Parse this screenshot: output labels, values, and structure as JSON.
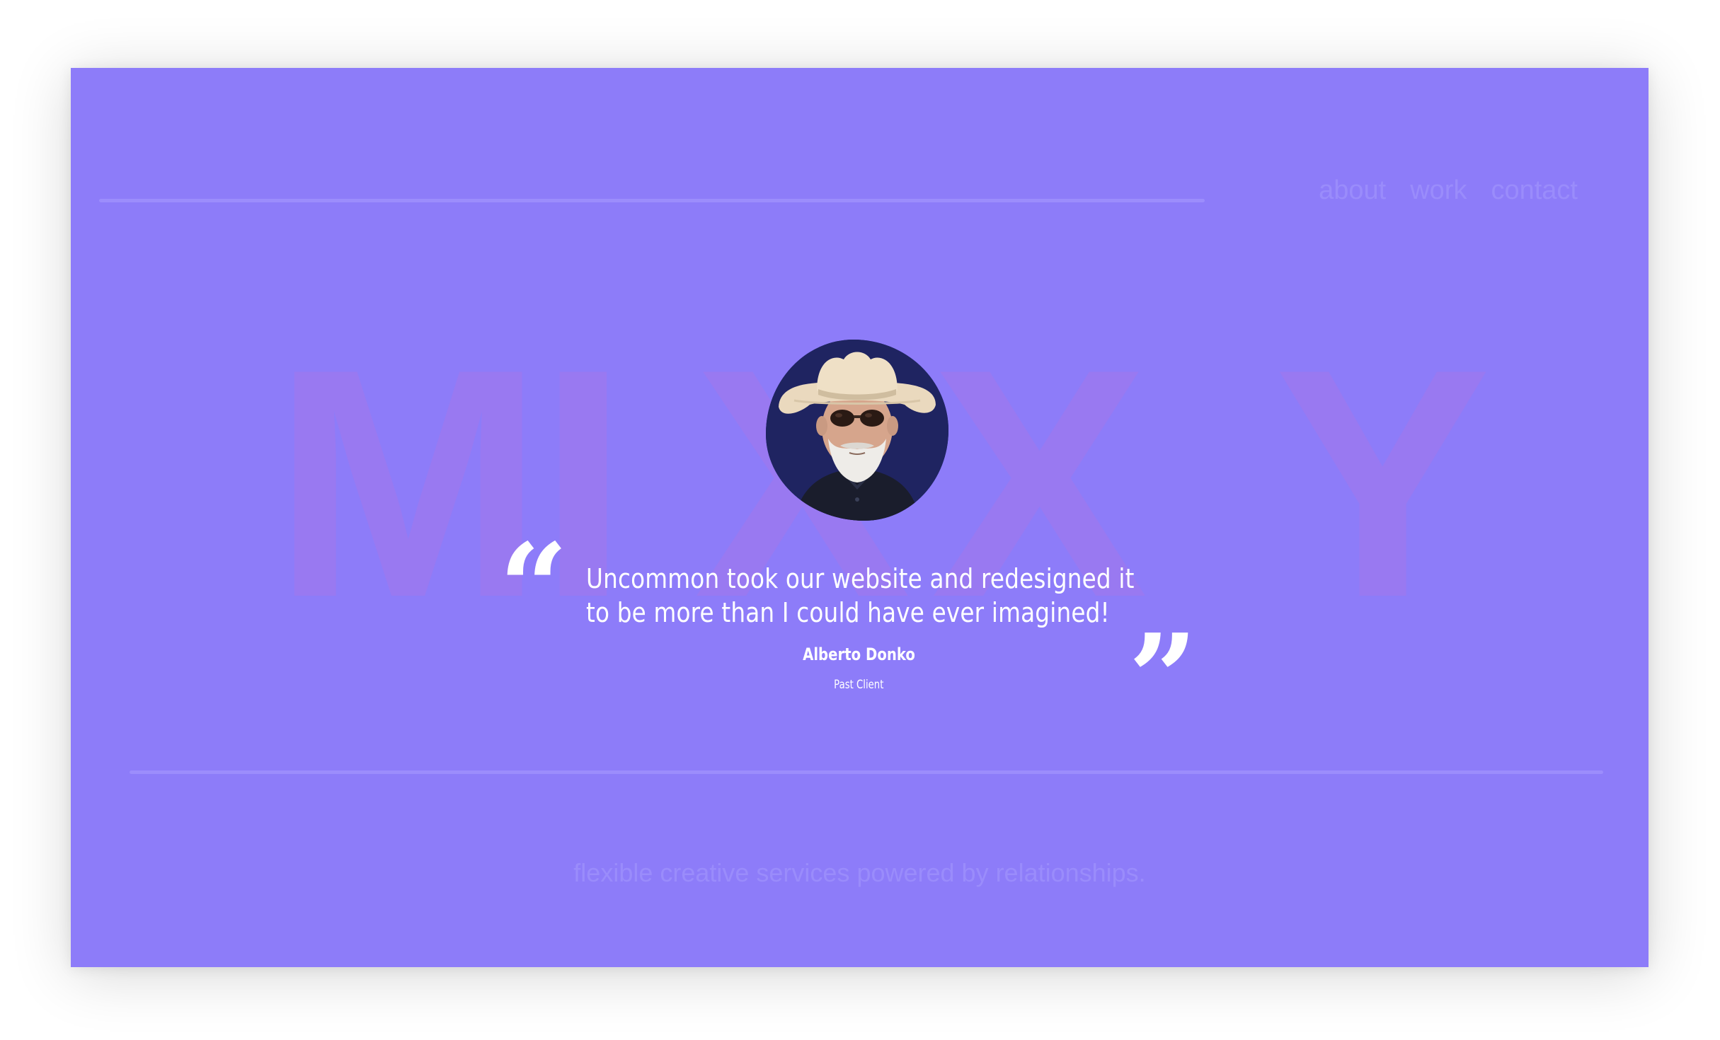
{
  "nav": {
    "items": [
      {
        "label": "about"
      },
      {
        "label": "work"
      },
      {
        "label": "contact"
      }
    ]
  },
  "hero": {
    "background_word": [
      "M",
      "I",
      "X",
      "X",
      "Y"
    ]
  },
  "testimonial": {
    "quote_lines": [
      "Uncommon took our website and redesigned it",
      "to be more than I could have ever imagined!"
    ],
    "open_quote_glyph": "“",
    "close_quote_glyph": "”",
    "author_name": "Alberto Donko",
    "author_role": "Past Client"
  },
  "footer": {
    "tagline": "flexible creative services powered by relationships."
  },
  "colors": {
    "card_background": "#8d7cf9",
    "accent_line": "#9c8dfc",
    "faded_text": "#9a8cfb",
    "background_word": "#9979f1",
    "avatar_background": "#1f2461",
    "foreground_text": "#ffffff"
  }
}
